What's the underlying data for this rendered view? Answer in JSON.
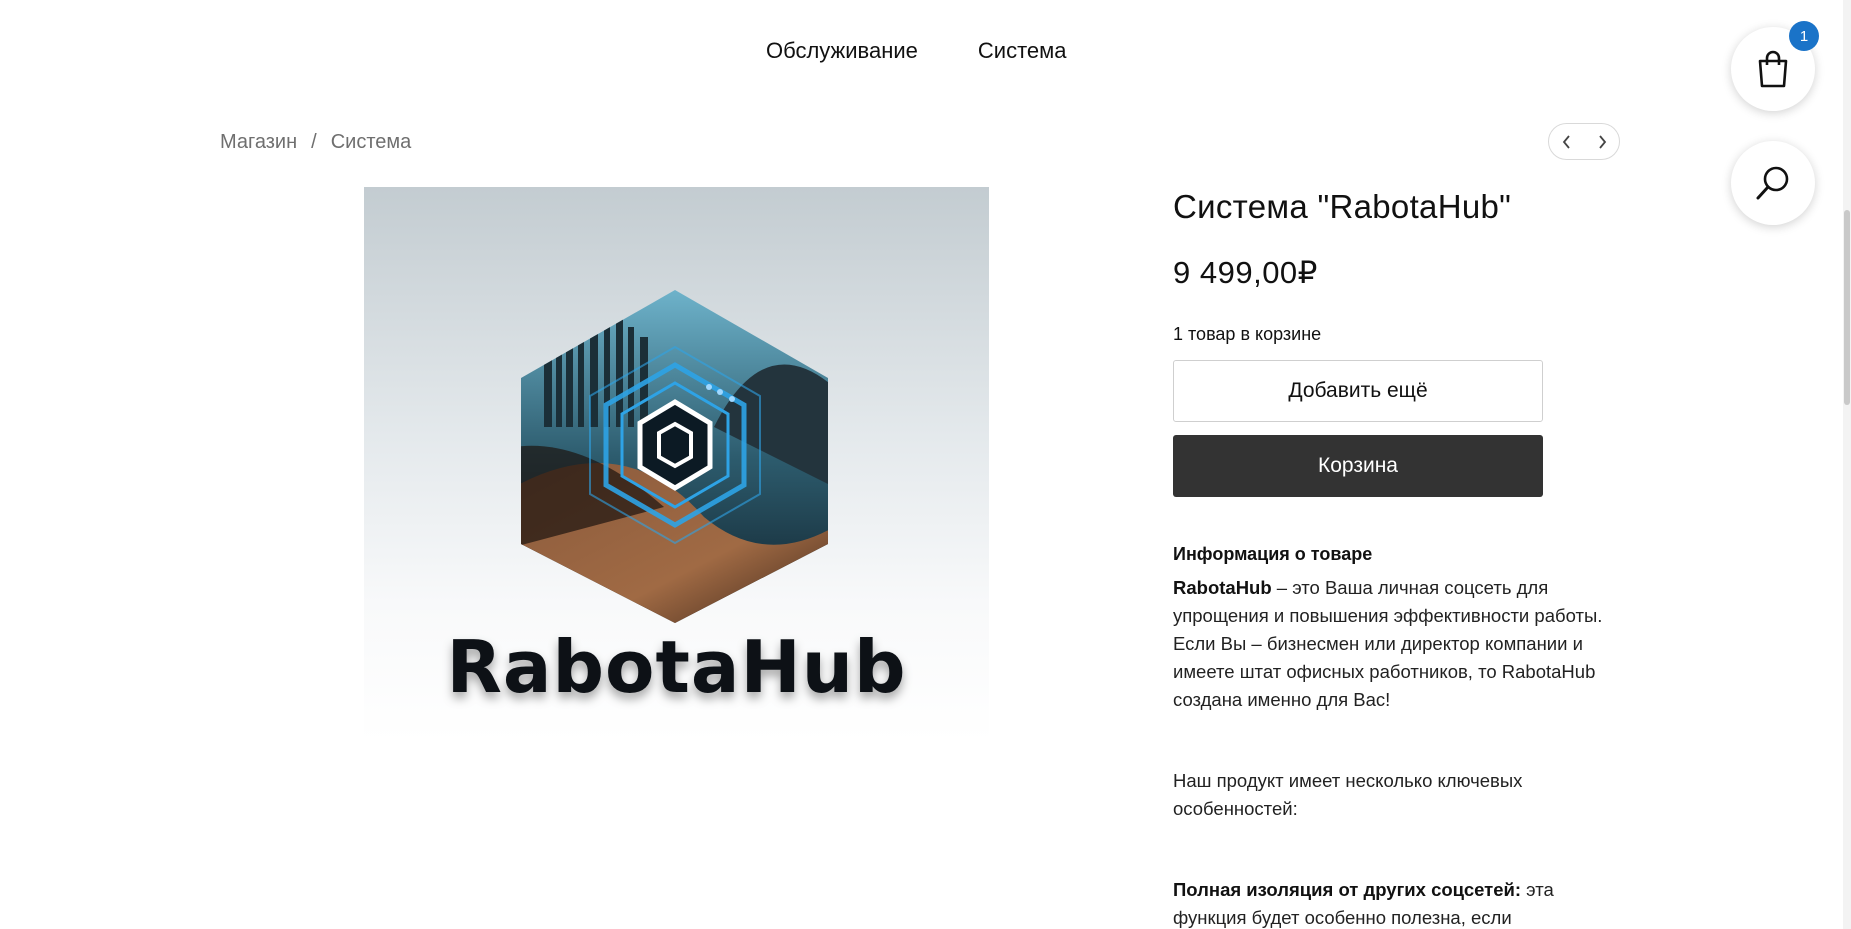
{
  "nav": {
    "items": [
      {
        "label": "Обслуживание"
      },
      {
        "label": "Система"
      }
    ]
  },
  "breadcrumb": {
    "root": "Магазин",
    "separator": "/",
    "current": "Система"
  },
  "cart_float": {
    "count": "1",
    "icon": "shopping-bag-icon",
    "badge_color": "#1a73c8"
  },
  "search_float": {
    "icon": "search-icon"
  },
  "product": {
    "image_logo_text": "RabotaHub",
    "title": "Система \"RabotaHub\"",
    "price": "9 499,00₽",
    "in_cart_text": "1 товар в корзине",
    "add_more_label": "Добавить ещё",
    "cart_label": "Корзина",
    "info_heading": "Информация о товаре",
    "desc1_bold": "RabotaHub",
    "desc1_rest": " – это Ваша личная соцсеть для упрощения и повышения эффективности работы. Если Вы – бизнесмен или директор компании и имеете штат офисных работников, то RabotaHub создана именно для Вас!",
    "desc2": "Наш продукт имеет несколько ключевых особенностей:",
    "desc3_bold": "Полная изоляция от других соцсетей:",
    "desc3_rest": " эта функция будет особенно полезна, если"
  },
  "colors": {
    "cart_button_bg": "#333333",
    "accent": "#1a73c8"
  }
}
